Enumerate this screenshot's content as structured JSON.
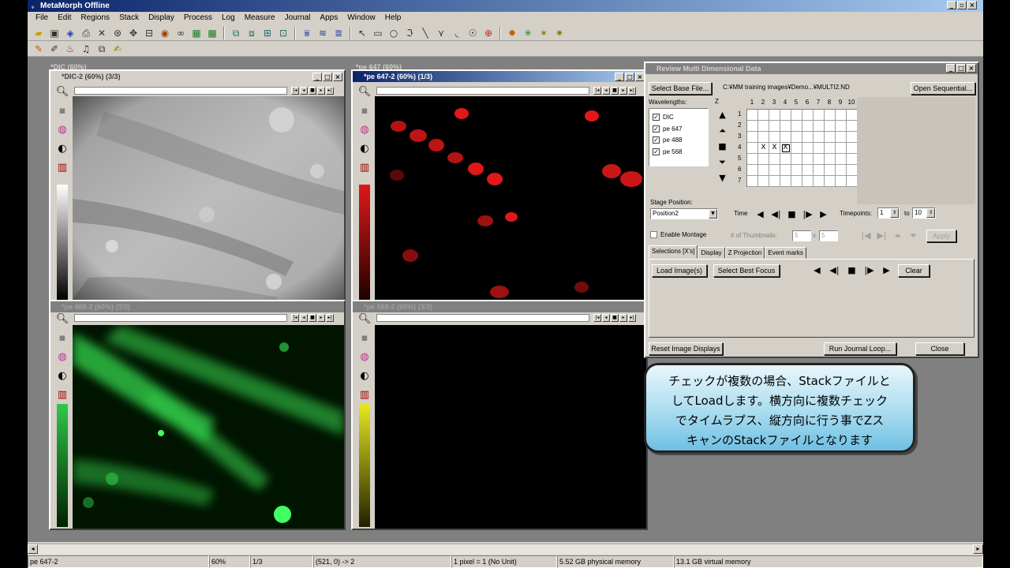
{
  "app": {
    "title": "MetaMorph Offline",
    "menu": [
      "File",
      "Edit",
      "Regions",
      "Stack",
      "Display",
      "Process",
      "Log",
      "Measure",
      "Journal",
      "Apps",
      "Window",
      "Help"
    ]
  },
  "windows": {
    "bg_dic_title": "*DIC (60%)",
    "bg_647_title": "*pe 647 (60%)",
    "dic2_title": "*DIC-2 (60%) (3/3)",
    "pe647_2_title": "*pe 647-2 (60%) (1/3)",
    "green_title": "*pe 488-2 (60%) (3/3)",
    "yellow_title": "*pe 568-2 (60%) (3/3)"
  },
  "dialog": {
    "title": "Review Multi Dimensional Data",
    "select_base_file": "Select Base File...",
    "base_path": "C:¥MM training images¥Demo...¥MULTI2.ND",
    "open_sequential": "Open Sequential...",
    "wavelengths_label": "Wavelengths:",
    "wavelengths": [
      {
        "name": "DIC",
        "checked": true
      },
      {
        "name": "pe 647",
        "checked": true
      },
      {
        "name": "pe 488",
        "checked": true
      },
      {
        "name": "pe 568",
        "checked": true
      }
    ],
    "z_label": "Z",
    "grid_cols": [
      "1",
      "2",
      "3",
      "4",
      "5",
      "6",
      "7",
      "8",
      "9",
      "10"
    ],
    "grid_rows": [
      "1",
      "2",
      "3",
      "4",
      "5",
      "6",
      "7"
    ],
    "grid_marks": "X",
    "stage_position_label": "Stage Position:",
    "stage_position_value": "Position2",
    "time_label": "Time",
    "timepoints_label": "Timepoints:",
    "timepoints_from": "1",
    "timepoints_to_label": "to",
    "timepoints_to": "10",
    "enable_montage": "Enable Montage",
    "num_thumbnails": "# of Thumbnails:",
    "thumb_x": "5",
    "thumb_x_sep": "x",
    "thumb_y": "5",
    "apply": "Apply",
    "tabs": [
      "Selections [X's]",
      "Display",
      "Z Projection",
      "Event marks"
    ],
    "load_images": "Load Image(s)",
    "select_best_focus": "Select Best Focus",
    "clear": "Clear",
    "reset_image_displays": "Reset Image Displays",
    "run_journal_loop": "Run Journal Loop...",
    "close": "Close"
  },
  "callout": {
    "line1": "チェックが複数の場合、Stackファイルと",
    "line2": "してLoadします。横方向に複数チェック",
    "line3": "でタイムラプス、縦方向に行う事でZス",
    "line4": "キャンのStackファイルとなります"
  },
  "status": {
    "image": "pe 647-2",
    "zoom": "60%",
    "plane": "1/3",
    "coords": "(521, 0) -> 2",
    "calibration": "1 pixel = 1 (No Unit)",
    "physical_memory": "5.52 GB physical memory",
    "virtual_memory": "13.1 GB virtual memory"
  },
  "colors": {
    "title_active": "#0a246a",
    "chrome": "#d4d0c8",
    "callout_fill": "#a9dcef",
    "red_channel": "#e01818",
    "green_channel": "#30c848"
  }
}
